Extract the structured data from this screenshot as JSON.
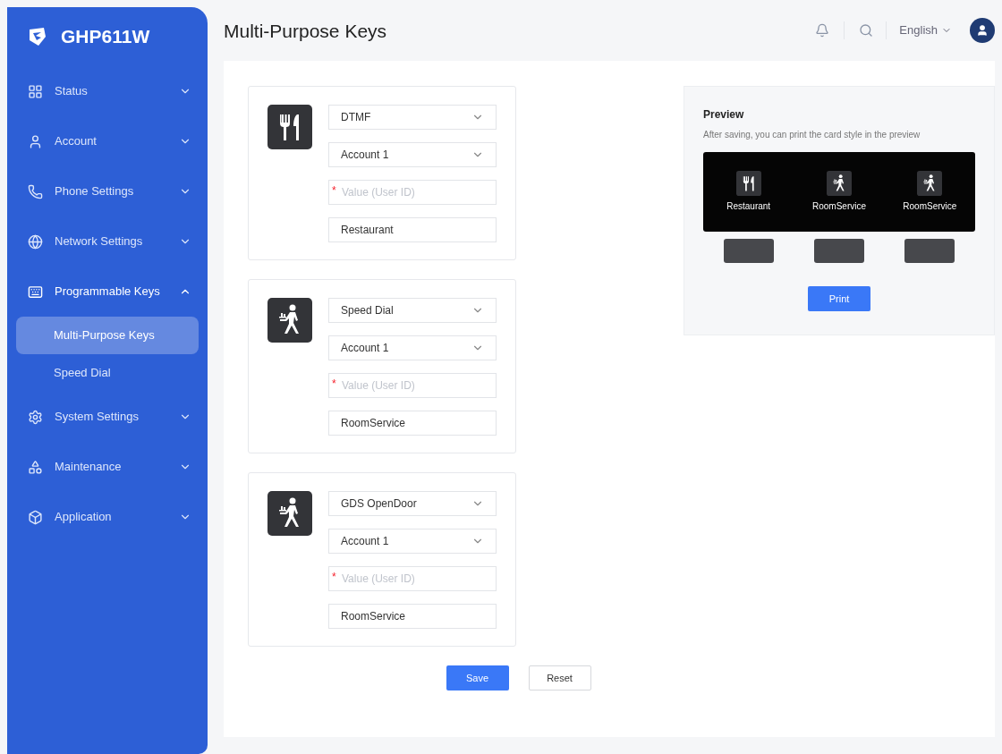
{
  "brand": {
    "name": "GHP611W"
  },
  "sidebar": {
    "items": [
      {
        "kind": "status",
        "label": "Status",
        "expanded": false
      },
      {
        "kind": "account",
        "label": "Account",
        "expanded": false
      },
      {
        "kind": "phone",
        "label": "Phone Settings",
        "expanded": false
      },
      {
        "kind": "network",
        "label": "Network Settings",
        "expanded": false
      },
      {
        "kind": "keys",
        "label": "Programmable Keys",
        "expanded": true,
        "children": [
          {
            "label": "Multi-Purpose Keys",
            "selected": true
          },
          {
            "label": "Speed Dial",
            "selected": false
          }
        ]
      },
      {
        "kind": "system",
        "label": "System Settings",
        "expanded": false
      },
      {
        "kind": "maintenance",
        "label": "Maintenance",
        "expanded": false
      },
      {
        "kind": "application",
        "label": "Application",
        "expanded": false
      }
    ]
  },
  "header": {
    "title": "Multi-Purpose Keys",
    "language": "English"
  },
  "keys": [
    {
      "kind": "restaurant",
      "mode": "DTMF",
      "account": "Account 1",
      "value": {
        "required_mark": "*",
        "placeholder": "Value (User ID)"
      },
      "label": "Restaurant"
    },
    {
      "kind": "room-service",
      "mode": "Speed Dial",
      "account": "Account 1",
      "value": {
        "required_mark": "*",
        "placeholder": "Value (User ID)"
      },
      "label": "RoomService"
    },
    {
      "kind": "room-service",
      "mode": "GDS OpenDoor",
      "account": "Account 1",
      "value": {
        "required_mark": "*",
        "placeholder": "Value (User ID)"
      },
      "label": "RoomService"
    }
  ],
  "preview": {
    "title": "Preview",
    "hint": "After saving, you can print the card style in the preview",
    "cards": [
      {
        "kind": "restaurant",
        "label": "Restaurant"
      },
      {
        "kind": "room-service",
        "label": "RoomService"
      },
      {
        "kind": "room-service",
        "label": "RoomService"
      }
    ],
    "print": "Print"
  },
  "actions": {
    "save": "Save",
    "reset": "Reset"
  }
}
